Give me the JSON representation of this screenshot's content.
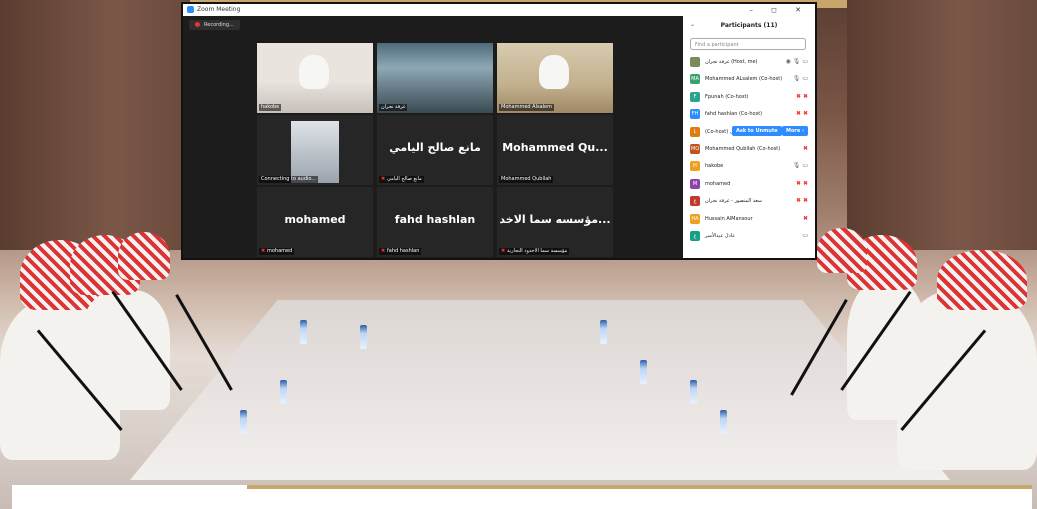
{
  "zoom": {
    "title": "Zoom Meeting",
    "recording": "Recording...",
    "tiles": [
      {
        "name": "hakobe",
        "big": "",
        "video": true,
        "muted": false,
        "active": false
      },
      {
        "name": "غرفة نجران",
        "big": "",
        "video": true,
        "muted": false,
        "active": false
      },
      {
        "name": "Mohammed Alsalem",
        "big": "",
        "video": true,
        "muted": false,
        "active": true
      },
      {
        "name": "Connecting to audio...",
        "big": "",
        "video": true,
        "muted": false,
        "active": false
      },
      {
        "name": "مانع صالح اليامي",
        "big": "مانع صالح اليامي",
        "video": false,
        "muted": true,
        "active": false
      },
      {
        "name": "Mohammed Qubllah",
        "big": "Mohammed  Qu...",
        "video": false,
        "muted": false,
        "active": false
      },
      {
        "name": "mohamed",
        "big": "mohamed",
        "video": false,
        "muted": true,
        "active": false
      },
      {
        "name": "fahd hashlan",
        "big": "fahd hashlan",
        "video": false,
        "muted": true,
        "active": false
      },
      {
        "name": "مؤسسة سما الاخدود التجارية",
        "big": "مؤسسه سما الاخد...",
        "video": false,
        "muted": true,
        "active": false
      }
    ],
    "window_controls": "– ◻ ✕",
    "participants": {
      "title": "Participants (11)",
      "search_placeholder": "Find a participant",
      "list": [
        {
          "initials": "",
          "color": "#7a8c5a",
          "name": "غرفة نجران (Host, me)",
          "icons": "◉ 🎙 ▭"
        },
        {
          "initials": "MA",
          "color": "#3ca26b",
          "name": "Mohammed ALsalem (Co-host)",
          "icons": "🎙 ▭"
        },
        {
          "initials": "F",
          "color": "#2aa58a",
          "name": "Fpunah (Co-host)",
          "icons": "✖ ✖"
        },
        {
          "initials": "FH",
          "color": "#2d8cff",
          "name": "fahd hashlan (Co-host)",
          "icons": "✖ ✖"
        },
        {
          "initials": "L",
          "color": "#e07b13",
          "name": "(Co-host) ل",
          "icons": ""
        },
        {
          "initials": "MQ",
          "color": "#c0531a",
          "name": "Mohammed Qubllah (Co-host)",
          "icons": "✖"
        },
        {
          "initials": "H",
          "color": "#f0a020",
          "name": "hakobe",
          "icons": "🎙 ▭"
        },
        {
          "initials": "M",
          "color": "#8e44ad",
          "name": "mohamed",
          "icons": "✖ ✖"
        },
        {
          "initials": "غ",
          "color": "#c0392b",
          "name": "سعد المنصور - غرفة نجران",
          "icons": "✖ ✖"
        },
        {
          "initials": "HA",
          "color": "#f0a020",
          "name": "Hussain AlMansour",
          "icons": "✖"
        },
        {
          "initials": "ع",
          "color": "#16a085",
          "name": "عادل عبدالأمير",
          "icons": "▭"
        }
      ],
      "ask_unmute": "Ask to Unmute",
      "more": "More ›"
    }
  }
}
